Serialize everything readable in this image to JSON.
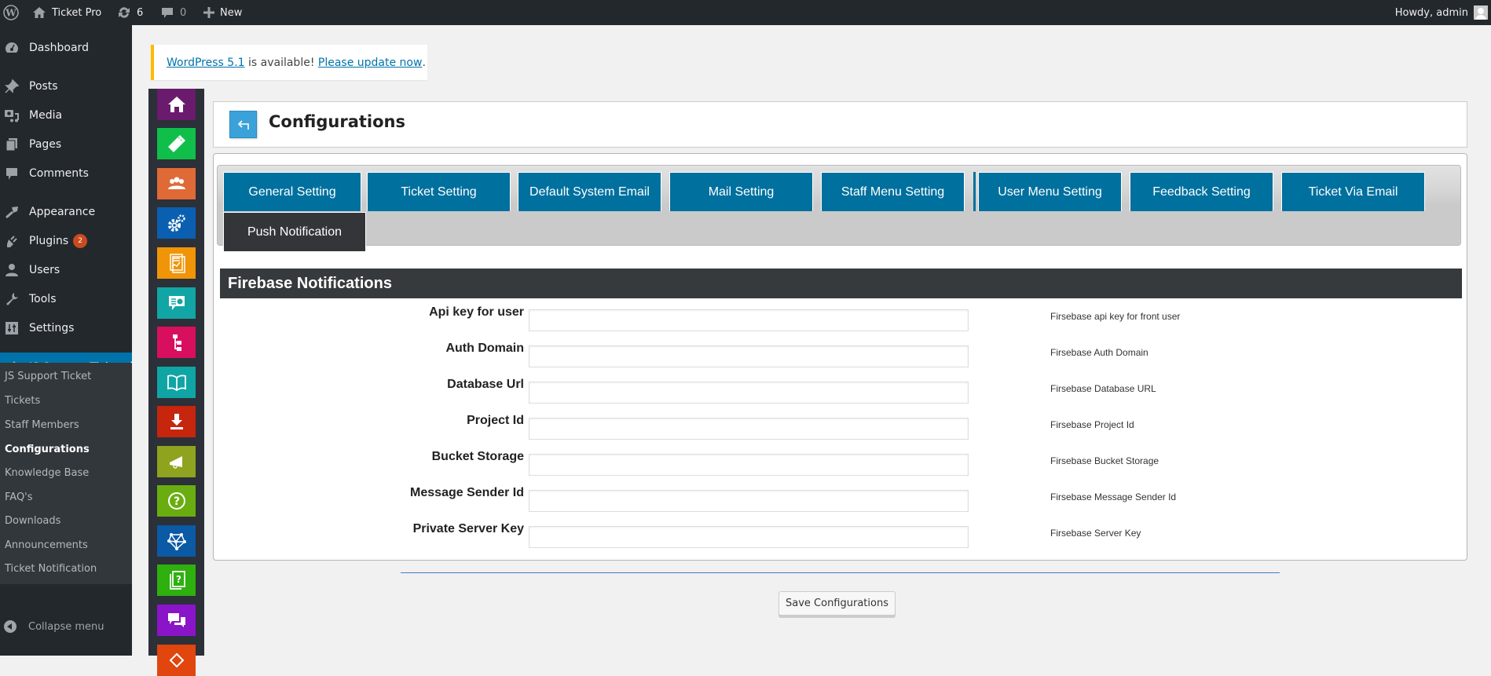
{
  "adminbar": {
    "site_name": "Ticket Pro",
    "updates_count": "6",
    "comments_count": "0",
    "new_label": "New",
    "howdy": "Howdy, admin"
  },
  "sidebar": {
    "items": [
      {
        "label": "Dashboard",
        "icon": "dashboard-icon"
      },
      {
        "label": "Posts",
        "icon": "pin-icon"
      },
      {
        "label": "Media",
        "icon": "media-icon"
      },
      {
        "label": "Pages",
        "icon": "pages-icon"
      },
      {
        "label": "Comments",
        "icon": "comment-icon"
      },
      {
        "label": "Appearance",
        "icon": "brush-icon"
      },
      {
        "label": "Plugins",
        "icon": "plugin-icon",
        "badge": "2"
      },
      {
        "label": "Users",
        "icon": "user-icon"
      },
      {
        "label": "Tools",
        "icon": "wrench-icon"
      },
      {
        "label": "Settings",
        "icon": "settings-icon"
      },
      {
        "label": "JS Support Ticket",
        "icon": "ticket-icon",
        "active": true
      }
    ],
    "submenu": [
      {
        "label": "JS Support Ticket"
      },
      {
        "label": "Tickets"
      },
      {
        "label": "Staff Members"
      },
      {
        "label": "Configurations",
        "current": true
      },
      {
        "label": "Knowledge Base"
      },
      {
        "label": "FAQ's"
      },
      {
        "label": "Downloads"
      },
      {
        "label": "Announcements"
      },
      {
        "label": "Ticket Notification"
      }
    ],
    "collapse_label": "Collapse menu"
  },
  "notice": {
    "link1": "WordPress 5.1",
    "text": " is available! ",
    "link2": "Please update now",
    "end": "."
  },
  "iconbar": [
    {
      "name": "home-icon",
      "color": "#6a1b6e"
    },
    {
      "name": "ticket-icon",
      "color": "#0fbf4a"
    },
    {
      "name": "staff-icon",
      "color": "#e06a36"
    },
    {
      "name": "configuration-gears-icon",
      "color": "#0a5fb0"
    },
    {
      "name": "report-icon",
      "color": "#ef9507"
    },
    {
      "name": "feedback-icon",
      "color": "#12a5a5"
    },
    {
      "name": "department-tree-icon",
      "color": "#d70f5e"
    },
    {
      "name": "knowledge-base-book-icon",
      "color": "#0fa5a5"
    },
    {
      "name": "download-icon",
      "color": "#c6250e"
    },
    {
      "name": "announcement-megaphone-icon",
      "color": "#8fa31e"
    },
    {
      "name": "faq-question-icon",
      "color": "#6aad10"
    },
    {
      "name": "network-icon",
      "color": "#0a5aa5"
    },
    {
      "name": "help-docs-icon",
      "color": "#2eb00e"
    },
    {
      "name": "chat-icon",
      "color": "#8a14c8"
    },
    {
      "name": "theme-icon",
      "color": "#e0460e"
    }
  ],
  "header": {
    "title": "Configurations"
  },
  "tabs": [
    {
      "label": "General Setting"
    },
    {
      "label": "Ticket Setting"
    },
    {
      "label": "Default System Email"
    },
    {
      "label": "Mail Setting"
    },
    {
      "label": "Staff Menu Setting"
    },
    {
      "label": "User Menu Setting"
    },
    {
      "label": "Feedback Setting"
    },
    {
      "label": "Ticket Via Email"
    },
    {
      "label": "Push Notification",
      "active": true
    }
  ],
  "section": {
    "title": "Firebase Notifications",
    "fields": [
      {
        "label": "Api key for user",
        "value": "",
        "description": "Firsebase api key for front user"
      },
      {
        "label": "Auth Domain",
        "value": "",
        "description": "Firsebase Auth Domain"
      },
      {
        "label": "Database Url",
        "value": "",
        "description": "Firsebase Database URL"
      },
      {
        "label": "Project Id",
        "value": "",
        "description": "Firsebase Project Id"
      },
      {
        "label": "Bucket Storage",
        "value": "",
        "description": "Firsebase Bucket Storage"
      },
      {
        "label": "Message Sender Id",
        "value": "",
        "description": "Firsebase Message Sender Id"
      },
      {
        "label": "Private Server Key",
        "value": "",
        "description": "Firsebase Server Key"
      }
    ]
  },
  "save_label": "Save Configurations"
}
